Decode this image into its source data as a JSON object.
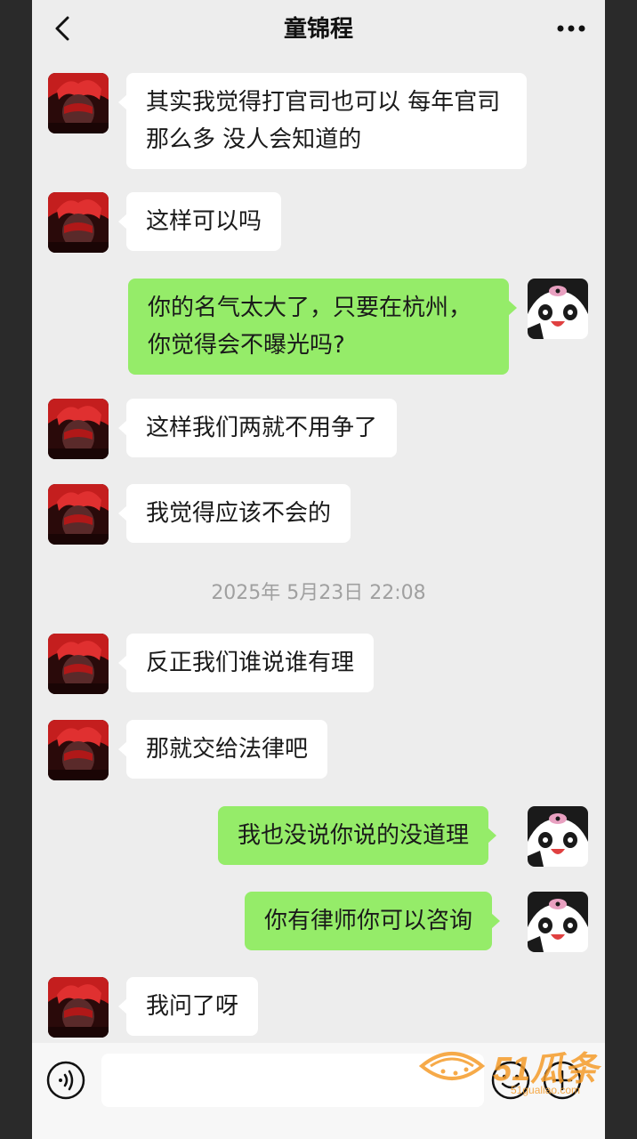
{
  "header": {
    "title": "童锦程",
    "back_icon": "chevron-left-icon",
    "more_icon": "more-dots-icon"
  },
  "messages": [
    {
      "side": "in",
      "text": "其实我觉得打官司也可以 每年官司那么多 没人会知道的"
    },
    {
      "side": "in",
      "text": "这样可以吗"
    },
    {
      "side": "out",
      "text": "你的名气太大了，只要在杭州，你觉得会不曝光吗?"
    },
    {
      "side": "in",
      "text": "这样我们两就不用争了"
    },
    {
      "side": "in",
      "text": "我觉得应该不会的"
    },
    {
      "side": "in",
      "text": "反正我们谁说谁有理"
    },
    {
      "side": "in",
      "text": "那就交给法律吧"
    },
    {
      "side": "out",
      "text": "我也没说你说的没道理"
    },
    {
      "side": "out",
      "text": "你有律师你可以咨询"
    },
    {
      "side": "in",
      "text": "我问了呀"
    }
  ],
  "timestamp": "2025年 5月23日 22:08",
  "input_bar": {
    "voice_icon": "voice-icon",
    "input_value": "",
    "emoji_icon": "emoji-icon",
    "plus_icon": "plus-icon"
  },
  "watermark": {
    "logo": "51瓜条",
    "url": "51gualiao.com"
  },
  "colors": {
    "background": "#ededed",
    "incoming_bubble": "#ffffff",
    "outgoing_bubble": "#95ec69"
  }
}
